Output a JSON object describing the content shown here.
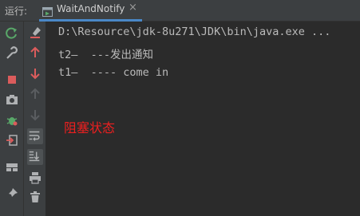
{
  "run_panel": {
    "label": "运行:",
    "tab": {
      "title": "WaitAndNotify"
    }
  },
  "console": {
    "lines": [
      "D:\\Resource\\jdk-8u271\\JDK\\bin\\java.exe ...",
      "t2—  ---发出通知",
      "t1—  ---- come in"
    ],
    "annotation": "阻塞状态"
  },
  "colors": {
    "background": "#2b2b2b",
    "panel": "#3c3f41",
    "annotation": "#ee1f1f",
    "tab_underline": "#4a88c7"
  },
  "toolbar_left": [
    "rerun-icon",
    "wrench-icon",
    "stop-icon",
    "camera-icon",
    "debug-bug-icon",
    "exit-icon",
    "layout-icon",
    "pin-icon"
  ],
  "toolbar_right": [
    "clear-icon",
    "up-arrow-icon",
    "down-arrow-icon",
    "up-trace-icon",
    "down-trace-icon",
    "soft-wrap-icon",
    "scroll-to-end-icon",
    "print-icon",
    "trash-icon"
  ]
}
